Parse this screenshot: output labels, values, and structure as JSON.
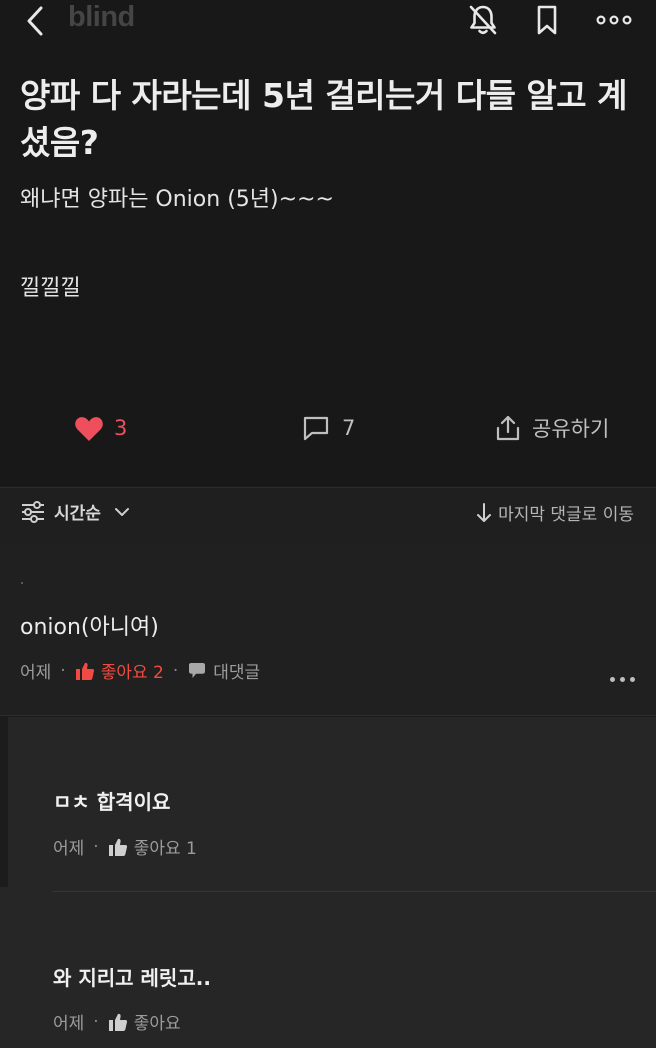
{
  "header": {
    "logo": "blind",
    "icons": [
      "back-icon",
      "bell-off-icon",
      "bookmark-icon",
      "more-icon"
    ]
  },
  "post": {
    "title": "양파 다 자라는데 5년 걸리는거 다들 알고 계셨음?",
    "body_line1": "왜냐면 양파는 Onion (5년)~~~",
    "body_line2": "낄낄낄",
    "likes": "3",
    "comments": "7",
    "share_label": "공유하기",
    "like_color": "#ef4f5d"
  },
  "sort": {
    "label": "시간순",
    "jump_label": "마지막 댓글로 이동"
  },
  "comments": [
    {
      "text": "onion(아니여)",
      "time": "어제",
      "like_label": "좋아요 2",
      "reply_label": "대댓글",
      "liked": true
    }
  ],
  "replies": [
    {
      "text": "ㅁㅊ 합격이요",
      "time": "어제",
      "like_label": "좋아요 1"
    },
    {
      "text": "와 지리고 레릿고..",
      "time": "어제",
      "like_label": "좋아요"
    }
  ]
}
